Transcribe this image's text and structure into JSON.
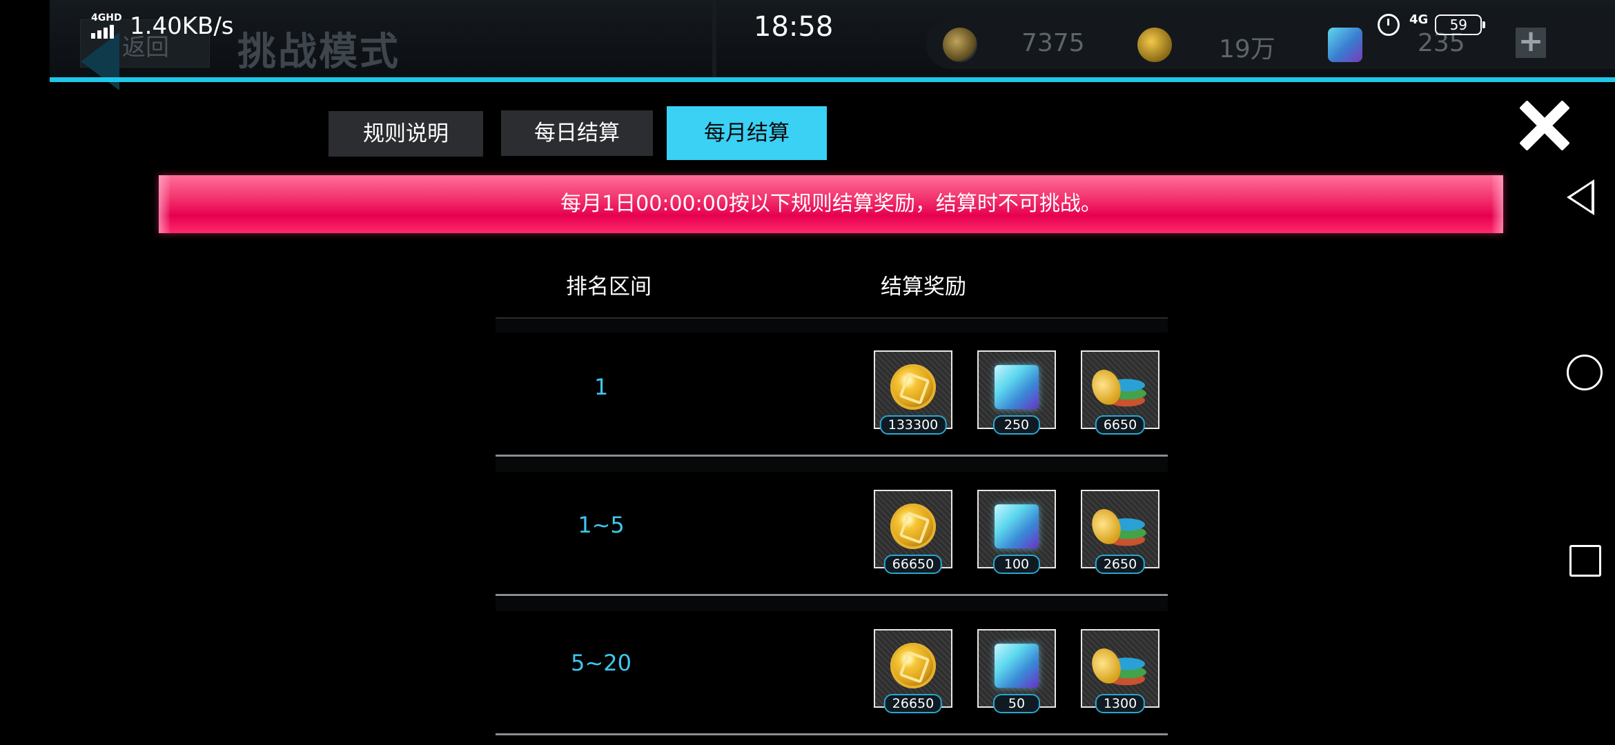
{
  "status_bar": {
    "network_label": "4GHD",
    "net_speed": "1.40KB/s",
    "time": "18:58",
    "net_type": "4G",
    "battery": "59"
  },
  "game_header": {
    "back_label": "返回",
    "title": "挑战模式",
    "currencies": [
      {
        "icon": "chips-icon",
        "value": "7375"
      },
      {
        "icon": "coin-icon",
        "value": "19万"
      },
      {
        "icon": "gem-icon",
        "value": "235"
      }
    ]
  },
  "tabs": [
    {
      "label": "规则说明",
      "active": false
    },
    {
      "label": "每日结算",
      "active": false
    },
    {
      "label": "每月结算",
      "active": true
    }
  ],
  "notice": "每月1日00:00:00按以下规则结算奖励，结算时不可挑战。",
  "table": {
    "headers": {
      "rank": "排名区间",
      "reward": "结算奖励"
    },
    "rows": [
      {
        "rank": "1",
        "rewards": [
          {
            "icon": "coin-icon",
            "count": "133300"
          },
          {
            "icon": "gem-icon",
            "count": "250"
          },
          {
            "icon": "chips-icon",
            "count": "6650"
          }
        ]
      },
      {
        "rank": "1~5",
        "rewards": [
          {
            "icon": "coin-icon",
            "count": "66650"
          },
          {
            "icon": "gem-icon",
            "count": "100"
          },
          {
            "icon": "chips-icon",
            "count": "2650"
          }
        ]
      },
      {
        "rank": "5~20",
        "rewards": [
          {
            "icon": "coin-icon",
            "count": "26650"
          },
          {
            "icon": "gem-icon",
            "count": "50"
          },
          {
            "icon": "chips-icon",
            "count": "1300"
          }
        ]
      }
    ]
  },
  "colors": {
    "accent_cyan": "#3bd1f5",
    "rank_text": "#3ec8ef",
    "notice_pink": "#f2336e"
  }
}
